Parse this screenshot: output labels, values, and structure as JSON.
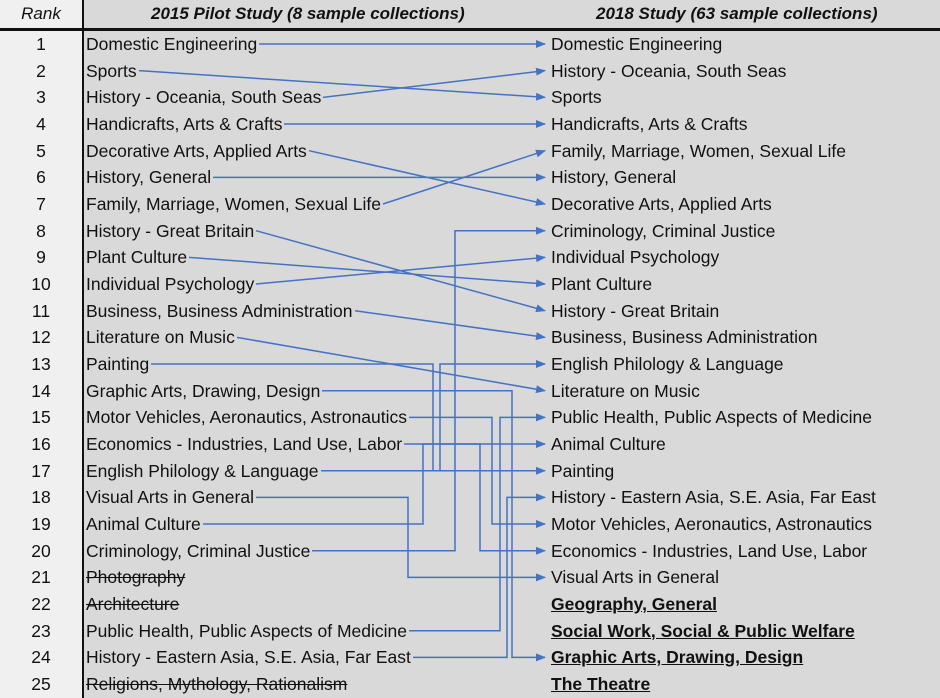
{
  "headers": {
    "rank": "Rank",
    "left": "2015 Pilot Study (8 sample collections)",
    "right": "2018 Study (63 sample collections)"
  },
  "colors": {
    "line": "#4472c4",
    "background": "#d9d9d9",
    "rank_background": "#f0f0f0"
  },
  "ranks": [
    "1",
    "2",
    "3",
    "4",
    "5",
    "6",
    "7",
    "8",
    "9",
    "10",
    "11",
    "12",
    "13",
    "14",
    "15",
    "16",
    "17",
    "18",
    "19",
    "20",
    "21",
    "22",
    "23",
    "24",
    "25"
  ],
  "left_items": [
    {
      "label": "Domestic Engineering",
      "dropped": false
    },
    {
      "label": "Sports",
      "dropped": false
    },
    {
      "label": "History - Oceania, South Seas",
      "dropped": false
    },
    {
      "label": "Handicrafts, Arts & Crafts",
      "dropped": false
    },
    {
      "label": "Decorative Arts, Applied Arts",
      "dropped": false
    },
    {
      "label": "History, General",
      "dropped": false
    },
    {
      "label": "Family, Marriage, Women, Sexual Life",
      "dropped": false
    },
    {
      "label": "History - Great Britain",
      "dropped": false
    },
    {
      "label": "Plant Culture",
      "dropped": false
    },
    {
      "label": "Individual Psychology",
      "dropped": false
    },
    {
      "label": "Business, Business Administration",
      "dropped": false
    },
    {
      "label": "Literature on Music",
      "dropped": false
    },
    {
      "label": "Painting",
      "dropped": false
    },
    {
      "label": "Graphic Arts, Drawing, Design",
      "dropped": false
    },
    {
      "label": "Motor Vehicles, Aeronautics, Astronautics",
      "dropped": false
    },
    {
      "label": "Economics - Industries, Land Use, Labor",
      "dropped": false
    },
    {
      "label": "English Philology & Language",
      "dropped": false
    },
    {
      "label": "Visual Arts in General",
      "dropped": false
    },
    {
      "label": "Animal Culture",
      "dropped": false
    },
    {
      "label": "Criminology, Criminal Justice",
      "dropped": false
    },
    {
      "label": "Photography",
      "dropped": true
    },
    {
      "label": "Architecture",
      "dropped": true
    },
    {
      "label": "Public Health, Public Aspects of Medicine",
      "dropped": false
    },
    {
      "label": "History - Eastern Asia, S.E. Asia, Far East",
      "dropped": false
    },
    {
      "label": "Religions, Mythology, Rationalism",
      "dropped": true
    }
  ],
  "right_items": [
    {
      "label": "Domestic Engineering",
      "new": false
    },
    {
      "label": "History - Oceania, South Seas",
      "new": false
    },
    {
      "label": "Sports",
      "new": false
    },
    {
      "label": "Handicrafts, Arts & Crafts",
      "new": false
    },
    {
      "label": "Family, Marriage, Women, Sexual Life",
      "new": false
    },
    {
      "label": "History, General",
      "new": false
    },
    {
      "label": "Decorative Arts, Applied Arts",
      "new": false
    },
    {
      "label": "Criminology, Criminal Justice",
      "new": false
    },
    {
      "label": "Individual Psychology",
      "new": false
    },
    {
      "label": "Plant Culture",
      "new": false
    },
    {
      "label": "History - Great Britain",
      "new": false
    },
    {
      "label": "Business, Business Administration",
      "new": false
    },
    {
      "label": "English Philology & Language",
      "new": false
    },
    {
      "label": "Literature on Music",
      "new": false
    },
    {
      "label": "Public Health, Public Aspects of Medicine",
      "new": false
    },
    {
      "label": "Animal Culture",
      "new": false
    },
    {
      "label": "Painting",
      "new": false
    },
    {
      "label": "History - Eastern Asia, S.E. Asia, Far East",
      "new": false
    },
    {
      "label": "Motor Vehicles, Aeronautics, Astronautics",
      "new": false
    },
    {
      "label": "Economics - Industries, Land Use, Labor",
      "new": false
    },
    {
      "label": "Visual Arts in General",
      "new": false
    },
    {
      "label": "Geography, General",
      "new": true
    },
    {
      "label": "Social Work, Social & Public Welfare",
      "new": true
    },
    {
      "label": "Graphic Arts, Drawing, Design",
      "new": true
    },
    {
      "label": "The Theatre",
      "new": true
    }
  ],
  "connections": [
    {
      "from": 1,
      "to": 1,
      "style": "straight"
    },
    {
      "from": 2,
      "to": 3,
      "style": "straight"
    },
    {
      "from": 3,
      "to": 2,
      "style": "straight"
    },
    {
      "from": 4,
      "to": 4,
      "style": "straight"
    },
    {
      "from": 5,
      "to": 7,
      "style": "straight"
    },
    {
      "from": 6,
      "to": 6,
      "style": "straight"
    },
    {
      "from": 7,
      "to": 5,
      "style": "straight"
    },
    {
      "from": 8,
      "to": 11,
      "style": "straight"
    },
    {
      "from": 9,
      "to": 10,
      "style": "straight"
    },
    {
      "from": 10,
      "to": 9,
      "style": "straight"
    },
    {
      "from": 11,
      "to": 12,
      "style": "straight"
    },
    {
      "from": 12,
      "to": 14,
      "style": "straight"
    },
    {
      "from": 13,
      "to": 17,
      "style": "elbow"
    },
    {
      "from": 14,
      "to": 24,
      "style": "elbow"
    },
    {
      "from": 15,
      "to": 19,
      "style": "elbow"
    },
    {
      "from": 16,
      "to": 20,
      "style": "elbow"
    },
    {
      "from": 17,
      "to": 13,
      "style": "elbow"
    },
    {
      "from": 18,
      "to": 21,
      "style": "elbow"
    },
    {
      "from": 19,
      "to": 16,
      "style": "elbow"
    },
    {
      "from": 20,
      "to": 8,
      "style": "elbow"
    },
    {
      "from": 23,
      "to": 15,
      "style": "elbow"
    },
    {
      "from": 24,
      "to": 18,
      "style": "elbow"
    }
  ]
}
